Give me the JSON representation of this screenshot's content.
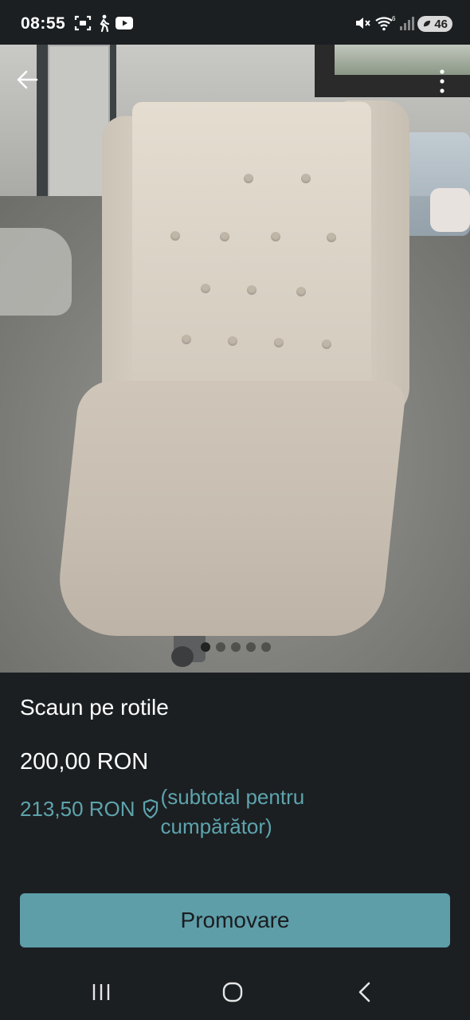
{
  "status_bar": {
    "time": "08:55",
    "battery_level": "46",
    "wifi_badge": "6",
    "icons": [
      "screenshot-icon",
      "walking-icon",
      "youtube-icon",
      "mute-icon",
      "wifi-icon",
      "signal-icon",
      "battery-icon"
    ]
  },
  "listing": {
    "title": "Scaun pe rotile",
    "price": "200,00 RON",
    "buyer_price": "213,50 RON",
    "buyer_note": "(subtotal pentru cumpărător)",
    "image_count": 5,
    "active_image_index": 0
  },
  "actions": {
    "promote_label": "Promovare"
  },
  "colors": {
    "background": "#1b1f22",
    "accent": "#5ea4ad",
    "button": "#5e9ea9"
  }
}
